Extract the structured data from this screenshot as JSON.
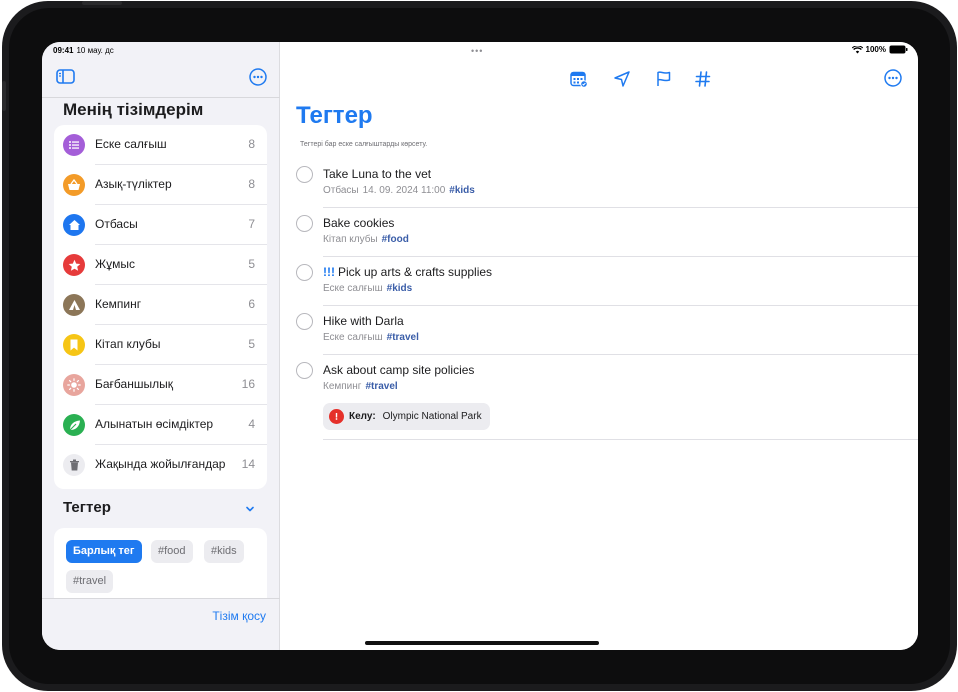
{
  "colors": {
    "accent": "#1f7af0",
    "tag_blue": "#3a5da8"
  },
  "status": {
    "time": "09:41",
    "date": "10 мау. дс",
    "dots": "•••",
    "battery": "100%"
  },
  "sidebar": {
    "my_lists_title": "Менің тізімдерім",
    "lists": [
      {
        "label": "Еске салғыш",
        "count": "8",
        "color": "#a45ed8",
        "icon": "list-icon"
      },
      {
        "label": "Азық-түліктер",
        "count": "8",
        "color": "#f39b28",
        "icon": "basket-icon"
      },
      {
        "label": "Отбасы",
        "count": "7",
        "color": "#1e76ef",
        "icon": "house-icon"
      },
      {
        "label": "Жұмыс",
        "count": "5",
        "color": "#e63b3b",
        "icon": "star-icon"
      },
      {
        "label": "Кемпинг",
        "count": "6",
        "color": "#8c7658",
        "icon": "tent-icon"
      },
      {
        "label": "Кітап клубы",
        "count": "5",
        "color": "#f6c515",
        "icon": "bookmark-icon"
      },
      {
        "label": "Бағбаншылық",
        "count": "16",
        "color": "#e8a59d",
        "icon": "sun-icon"
      },
      {
        "label": "Алынатын өсімдіктер",
        "count": "4",
        "color": "#2ab052",
        "icon": "leaf-icon"
      },
      {
        "label": "Жақында жойылғандар",
        "count": "14",
        "color": "#ececf0",
        "icon": "trash-icon"
      }
    ],
    "tags_title": "Тегтер",
    "tags": [
      "Барлық тег",
      "#food",
      "#kids",
      "#travel"
    ],
    "add_list": "Тізім қосу"
  },
  "main": {
    "title": "Тегтер",
    "subtitle": "Тегтері бар еске салғыштарды көрсету.",
    "reminders": [
      {
        "title": "Take Luna to the vet",
        "priority": "",
        "list": "Отбасы",
        "date": "14. 09. 2024 11:00",
        "tag": "#kids"
      },
      {
        "title": "Bake cookies",
        "priority": "",
        "list": "Кітап клубы",
        "date": "",
        "tag": "#food"
      },
      {
        "title": "Pick up arts & crafts supplies",
        "priority": "!!!",
        "list": "Еске салғыш",
        "date": "",
        "tag": "#kids"
      },
      {
        "title": "Hike with Darla",
        "priority": "",
        "list": "Еске салғыш",
        "date": "",
        "tag": "#travel"
      },
      {
        "title": "Ask about camp site policies",
        "priority": "",
        "list": "Кемпинг",
        "date": "",
        "tag": "#travel"
      }
    ],
    "location_chip": {
      "label": "Келу:",
      "place": "Olympic National Park"
    }
  }
}
